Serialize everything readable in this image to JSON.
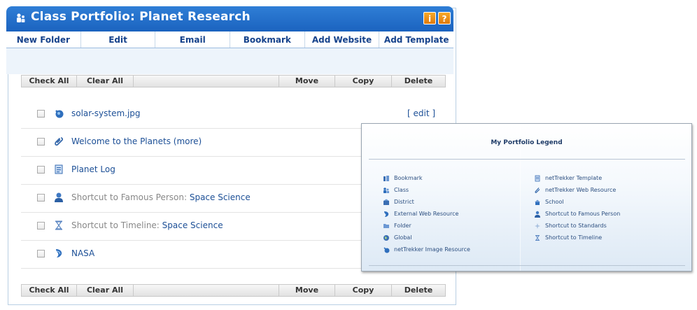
{
  "header": {
    "title": "Class Portfolio: Planet Research",
    "info_label": "i",
    "help_label": "?"
  },
  "toolbar": {
    "items": [
      "New Folder",
      "Edit",
      "Email",
      "Bookmark",
      "Add Website",
      "Add Template"
    ]
  },
  "actionbar": {
    "check_all": "Check All",
    "clear_all": "Clear All",
    "move": "Move",
    "copy": "Copy",
    "delete": "Delete"
  },
  "rows": [
    {
      "icon": "image-resource-icon",
      "name": "solar-system.jpg",
      "prefix": "",
      "edit": "[ edit ]"
    },
    {
      "icon": "web-resource-icon",
      "name": "Welcome to the Planets (more)",
      "prefix": "",
      "edit": ""
    },
    {
      "icon": "template-icon",
      "name": "Planet Log",
      "prefix": "",
      "edit": ""
    },
    {
      "icon": "famous-person-icon",
      "name": "Space Science",
      "prefix": "Shortcut to Famous Person: ",
      "edit": ""
    },
    {
      "icon": "timeline-icon",
      "name": "Space Science",
      "prefix": "Shortcut to Timeline: ",
      "edit": ""
    },
    {
      "icon": "external-web-resource-icon",
      "name": "NASA",
      "prefix": "",
      "edit": ""
    }
  ],
  "legend": {
    "title": "My Portfolio Legend",
    "left": [
      "Bookmark",
      "Class",
      "District",
      "External Web Resource",
      "Folder",
      "Global",
      "netTrekker Image Resource"
    ],
    "right": [
      "netTrekker Template",
      "netTrekker Web Resource",
      "School",
      "Shortcut to Famous Person",
      "Shortcut to Standards",
      "Shortcut to Timeline"
    ]
  },
  "colors": {
    "title_bar": "#1b63bf",
    "link": "#1c4f96",
    "help_button": "#e07a0c"
  }
}
